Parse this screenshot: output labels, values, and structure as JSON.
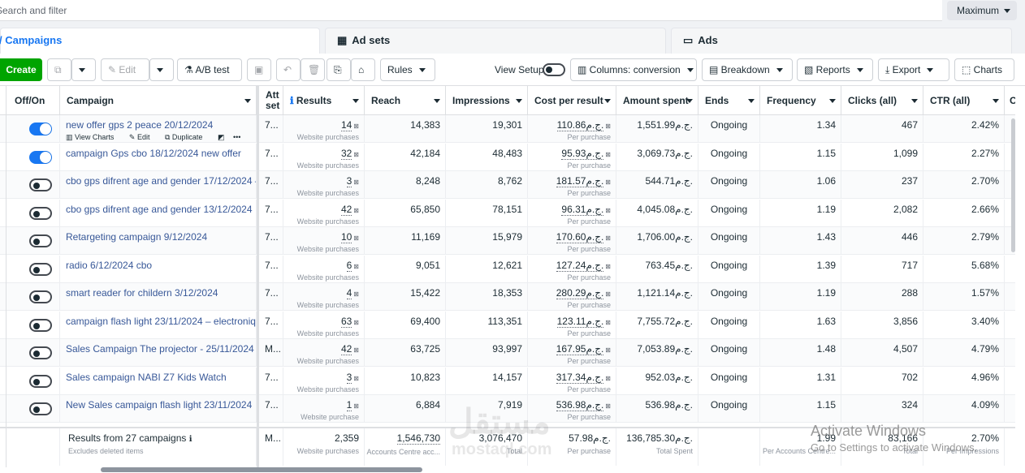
{
  "search": {
    "placeholder": "Search and filter"
  },
  "max_select": {
    "value": "Maximum"
  },
  "tabs": [
    {
      "label": "Campaigns",
      "icon": "folder-icon"
    },
    {
      "label": "Ad sets",
      "icon": "grid-icon"
    },
    {
      "label": "Ads",
      "icon": "ad-icon"
    }
  ],
  "toolbar": {
    "create": "Create",
    "edit": "Edit",
    "ab_test": "A/B test",
    "rules": "Rules",
    "view_setup": "View Setup",
    "columns": "Columns: conversion",
    "breakdown": "Breakdown",
    "reports": "Reports",
    "export": "Export",
    "charts": "Charts"
  },
  "columns": [
    "Off/On",
    "Campaign",
    "Att set",
    "Results",
    "Reach",
    "Impressions",
    "Cost per result",
    "Amount spent",
    "Ends",
    "Frequency",
    "Clicks (all)",
    "CTR (all)",
    "C"
  ],
  "row_actions": {
    "view_charts": "View Charts",
    "edit": "Edit",
    "duplicate": "Duplicate",
    "more": "•••"
  },
  "rows": [
    {
      "on": true,
      "name": "new offer gps 2 peace 20/12/2024",
      "att": "7...",
      "results": "14",
      "results_sub": "Website purchases",
      "reach": "14,383",
      "impressions": "19,301",
      "cpr": "110.86ج.م.",
      "cpr_sub": "Per purchase",
      "spent": "1,551.99ج.م.",
      "ends": "Ongoing",
      "freq": "1.34",
      "clicks": "467",
      "ctr": "2.42%"
    },
    {
      "on": true,
      "name": "campaign Gps cbo 18/12/2024 new offer",
      "att": "7...",
      "results": "32",
      "results_sub": "Website purchases",
      "reach": "42,184",
      "impressions": "48,483",
      "cpr": "95.93ج.م.",
      "cpr_sub": "Per purchase",
      "spent": "3,069.73ج.م.",
      "ends": "Ongoing",
      "freq": "1.15",
      "clicks": "1,099",
      "ctr": "2.27%"
    },
    {
      "on": false,
      "name": "cbo gps difrent age and gender 17/12/2024 –",
      "att": "7...",
      "results": "3",
      "results_sub": "Website purchases",
      "reach": "8,248",
      "impressions": "8,762",
      "cpr": "181.57ج.م.",
      "cpr_sub": "Per purchase",
      "spent": "544.71ج.م.",
      "ends": "Ongoing",
      "freq": "1.06",
      "clicks": "237",
      "ctr": "2.70%"
    },
    {
      "on": false,
      "name": "cbo gps difrent age and gender 13/12/2024",
      "att": "7...",
      "results": "42",
      "results_sub": "Website purchases",
      "reach": "65,850",
      "impressions": "78,151",
      "cpr": "96.31ج.م.",
      "cpr_sub": "Per purchase",
      "spent": "4,045.08ج.م.",
      "ends": "Ongoing",
      "freq": "1.19",
      "clicks": "2,082",
      "ctr": "2.66%"
    },
    {
      "on": false,
      "name": "Retargeting campaign 9/12/2024",
      "att": "7...",
      "results": "10",
      "results_sub": "Website purchases",
      "reach": "11,169",
      "impressions": "15,979",
      "cpr": "170.60ج.م.",
      "cpr_sub": "Per purchase",
      "spent": "1,706.00ج.م.",
      "ends": "Ongoing",
      "freq": "1.43",
      "clicks": "446",
      "ctr": "2.79%"
    },
    {
      "on": false,
      "name": "radio 6/12/2024 cbo",
      "att": "7...",
      "results": "6",
      "results_sub": "Website purchases",
      "reach": "9,051",
      "impressions": "12,621",
      "cpr": "127.24ج.م.",
      "cpr_sub": "Per purchase",
      "spent": "763.45ج.م.",
      "ends": "Ongoing",
      "freq": "1.39",
      "clicks": "717",
      "ctr": "5.68%"
    },
    {
      "on": false,
      "name": "smart reader for childern 3/12/2024",
      "att": "7...",
      "results": "4",
      "results_sub": "Website purchases",
      "reach": "15,422",
      "impressions": "18,353",
      "cpr": "280.29ج.م.",
      "cpr_sub": "Per purchase",
      "spent": "1,121.14ج.م.",
      "ends": "Ongoing",
      "freq": "1.19",
      "clicks": "288",
      "ctr": "1.57%"
    },
    {
      "on": false,
      "name": "campaign flash light 23/11/2024 – electroniq",
      "att": "7...",
      "results": "63",
      "results_sub": "Website purchases",
      "reach": "69,400",
      "impressions": "113,351",
      "cpr": "123.11ج.م.",
      "cpr_sub": "Per purchase",
      "spent": "7,755.72ج.م.",
      "ends": "Ongoing",
      "freq": "1.63",
      "clicks": "3,856",
      "ctr": "3.40%"
    },
    {
      "on": false,
      "name": "Sales Campaign The projector - 25/11/2024",
      "att": "M...",
      "results": "42",
      "results_sub": "Website purchases",
      "reach": "63,725",
      "impressions": "93,997",
      "cpr": "167.95ج.م.",
      "cpr_sub": "Per purchase",
      "spent": "7,053.89ج.م.",
      "ends": "Ongoing",
      "freq": "1.48",
      "clicks": "4,507",
      "ctr": "4.79%"
    },
    {
      "on": false,
      "name": "Sales campaign NABI Z7 Kids Watch",
      "att": "7...",
      "results": "3",
      "results_sub": "Website purchases",
      "reach": "10,823",
      "impressions": "14,157",
      "cpr": "317.34ج.م.",
      "cpr_sub": "Per purchase",
      "spent": "952.03ج.م.",
      "ends": "Ongoing",
      "freq": "1.31",
      "clicks": "702",
      "ctr": "4.96%"
    },
    {
      "on": false,
      "name": "New Sales campaign flash light 23/11/2024",
      "att": "7...",
      "results": "1",
      "results_sub": "Website purchase",
      "reach": "6,884",
      "impressions": "7,919",
      "cpr": "536.98ج.م.",
      "cpr_sub": "Per purchase",
      "spent": "536.98ج.م.",
      "ends": "Ongoing",
      "freq": "1.15",
      "clicks": "324",
      "ctr": "4.09%"
    }
  ],
  "footer": {
    "label": "Results from 27 campaigns",
    "sub": "Excludes deleted items",
    "att": "M...",
    "results": "2,359",
    "results_sub": "Website purchases",
    "reach": "1,546,730",
    "reach_sub": "Accounts Centre acc...",
    "impressions": "3,076,470",
    "impressions_sub": "Total",
    "cpr": "57.98ج.م.",
    "cpr_sub": "Per purchase",
    "spent": "136,785.30ج.م.",
    "spent_sub": "Total Spent",
    "freq": "1.99",
    "freq_sub": "Per Accounts Centre...",
    "clicks": "83,166",
    "clicks_sub": "Total",
    "ctr": "2.70%",
    "ctr_sub": "Per Impressions"
  },
  "watermark": {
    "main": "مستقل",
    "sub": "mostaql.com"
  },
  "activate": {
    "title": "Activate Windows",
    "sub": "Go to Settings to activate Windows."
  }
}
